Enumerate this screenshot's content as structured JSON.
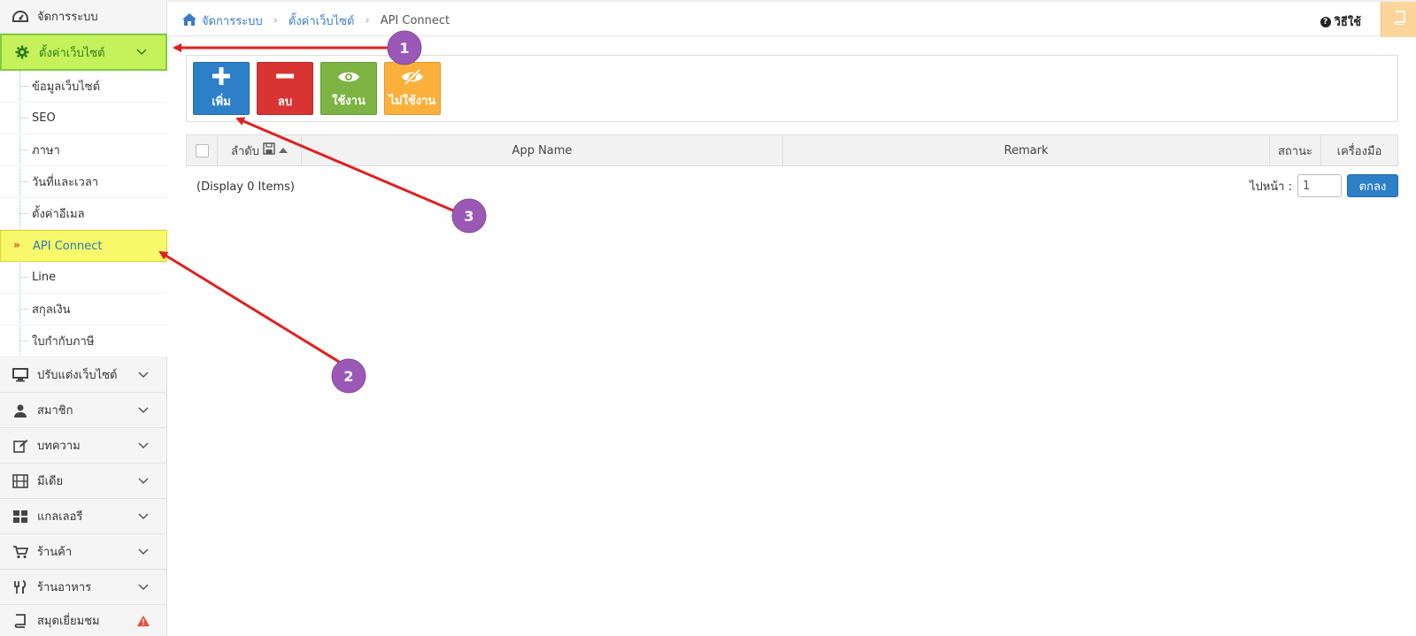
{
  "sidebar": {
    "top_item": {
      "label": "จัดการระบบ",
      "icon": "dashboard-icon"
    },
    "active_section": {
      "label": "ตั้งค่าเว็บไซต์",
      "icon": "gear-icon"
    },
    "submenu": [
      {
        "label": "ข้อมูลเว็บไซต์"
      },
      {
        "label": "SEO"
      },
      {
        "label": "ภาษา"
      },
      {
        "label": "วันที่และเวลา"
      },
      {
        "label": "ตั้งค่าอีเมล"
      },
      {
        "label": "API Connect",
        "selected": true,
        "marker": "»"
      },
      {
        "label": "Line"
      },
      {
        "label": "สกุลเงิน"
      },
      {
        "label": "ใบกำกับภาษี"
      }
    ],
    "sections": [
      {
        "label": "ปรับแต่งเว็บไซต์",
        "icon": "monitor-icon"
      },
      {
        "label": "สมาชิก",
        "icon": "user-icon"
      },
      {
        "label": "บทความ",
        "icon": "edit-icon"
      },
      {
        "label": "มีเดีย",
        "icon": "film-icon"
      },
      {
        "label": "แกลเลอรี",
        "icon": "grid-icon"
      },
      {
        "label": "ร้านค้า",
        "icon": "cart-icon"
      },
      {
        "label": "ร้านอาหาร",
        "icon": "utensils-icon"
      },
      {
        "label": "สมุดเยี่ยมชม",
        "icon": "book-icon"
      }
    ]
  },
  "breadcrumb": {
    "home": "จัดการระบบ",
    "parent": "ตั้งค่าเว็บไซต์",
    "current": "API Connect"
  },
  "help": {
    "label": "วิธีใช้"
  },
  "toolbar": {
    "add_label": "เพิ่ม",
    "delete_label": "ลบ",
    "enable_label": "ใช้งาน",
    "disable_label": "ไม่ใช้งาน"
  },
  "table": {
    "headers": {
      "order": "ลำดับ",
      "app_name": "App Name",
      "remark": "Remark",
      "status": "สถานะ",
      "tools": "เครื่องมือ"
    },
    "rows": []
  },
  "list_footer": {
    "display_count": "(Display 0 Items)",
    "goto_label": "ไปหน้า :",
    "page_value": "1",
    "go_button": "ตกลง"
  },
  "annotations": {
    "badges": [
      "1",
      "2",
      "3"
    ],
    "badge_color": "#9b59b6",
    "arrow_color": "#e02020"
  },
  "colors": {
    "active_section_bg": "#c5f25a",
    "selected_item_bg": "#f7f86a",
    "add_button": "#2d7fc8",
    "delete_button": "#d83434",
    "enable_button": "#7cb342",
    "disable_button": "#fbb03b"
  }
}
